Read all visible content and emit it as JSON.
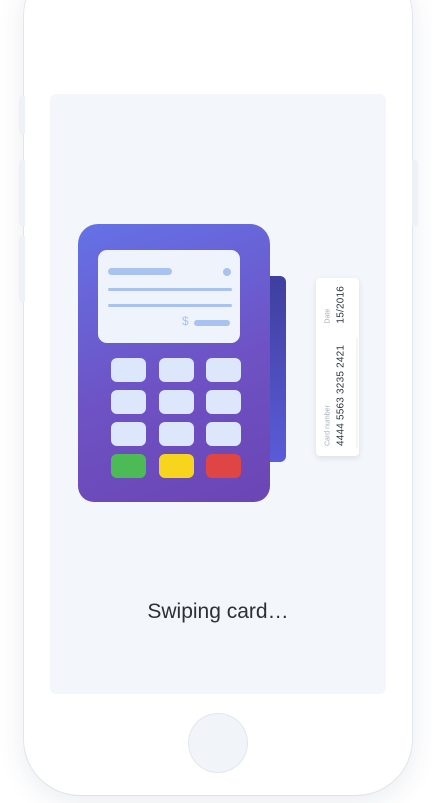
{
  "status_text": "Swiping card…",
  "card": {
    "number_label": "Card number",
    "number": "4444 5563 3235 2421",
    "date_label": "Date",
    "date": "15/2016"
  },
  "terminal": {
    "currency_symbol": "$",
    "keypad_rows": 3,
    "keypad_cols": 3,
    "action_keys": [
      {
        "name": "green-action-key",
        "color": "#4cbb55"
      },
      {
        "name": "yellow-action-key",
        "color": "#f7d51c"
      },
      {
        "name": "red-action-key",
        "color": "#e04545"
      }
    ]
  },
  "colors": {
    "terminal_gradient_start": "#6472e6",
    "terminal_gradient_end": "#6b45b4",
    "screen_background": "#f3f6fa",
    "key_color": "#dce7fb"
  },
  "icons": [
    "home-button"
  ]
}
